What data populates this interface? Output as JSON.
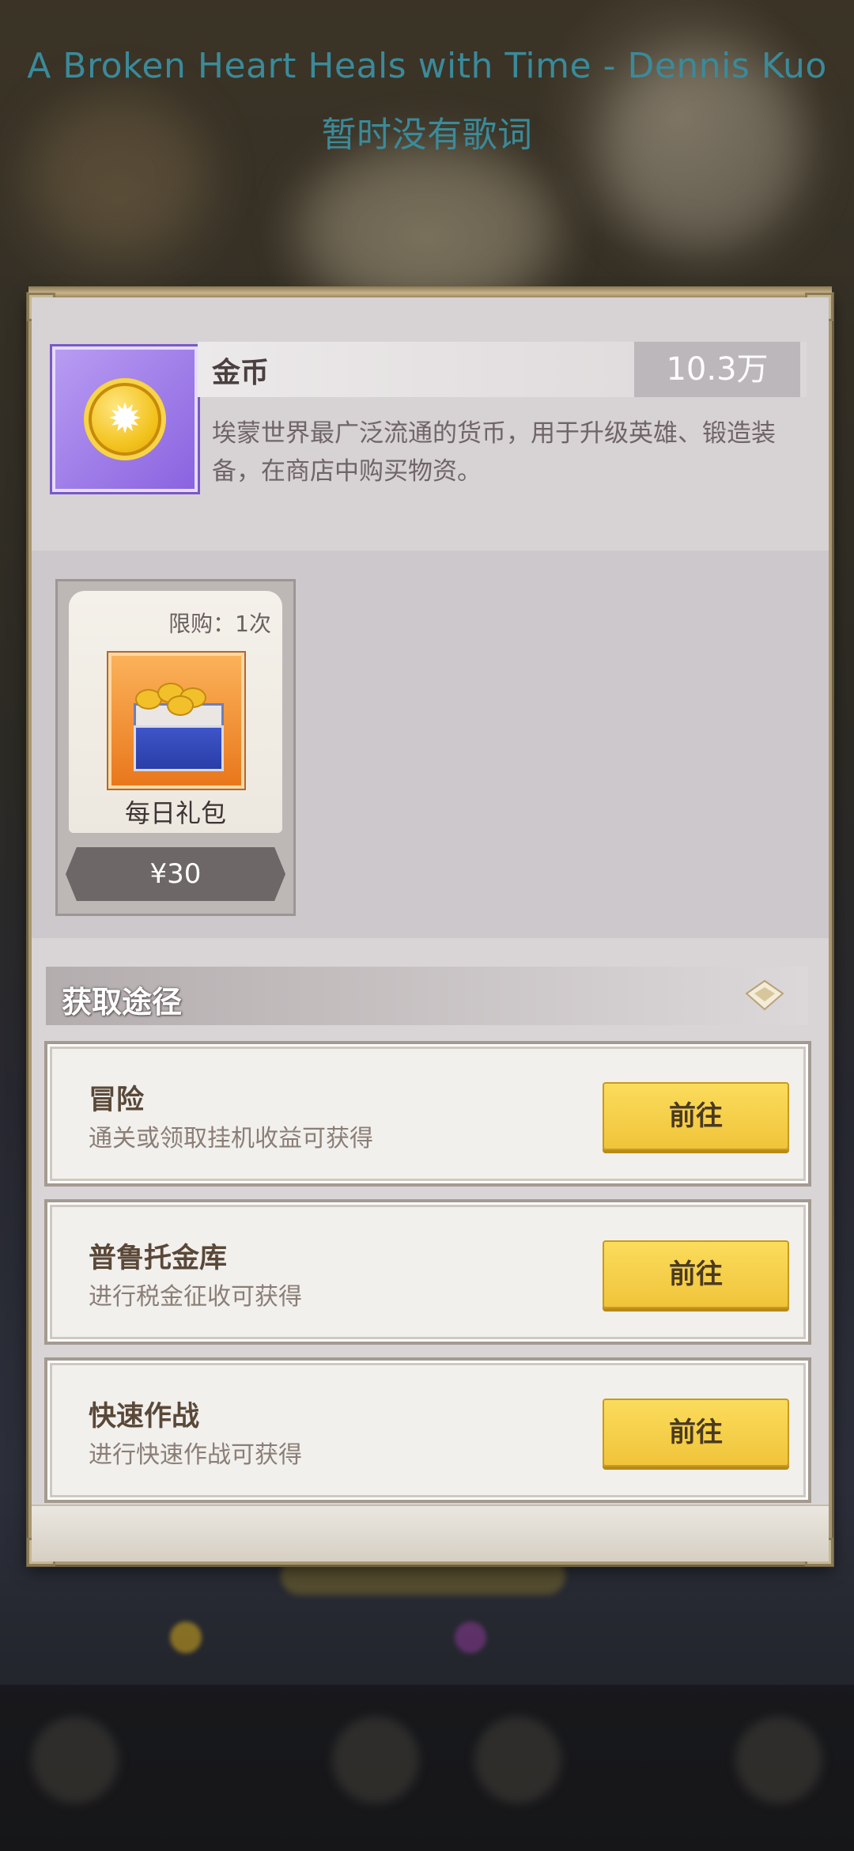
{
  "lyrics": {
    "line1": "A Broken Heart Heals with Time - Dennis Kuo",
    "line2": "暂时没有歌词"
  },
  "item": {
    "name": "金币",
    "quantity": "10.3万",
    "description": "埃蒙世界最广泛流通的货币，用于升级英雄、锻造装备，在商店中购买物资。",
    "icon": "gold-coin-icon"
  },
  "shop": {
    "pack_limit": "限购：1次",
    "pack_name": "每日礼包",
    "pack_price": "¥30"
  },
  "sources": {
    "header": "获取途径",
    "items": [
      {
        "title": "冒险",
        "desc": "通关或领取挂机收益可获得",
        "button": "前往"
      },
      {
        "title": "普鲁托金库",
        "desc": "进行税金征收可获得",
        "button": "前往"
      },
      {
        "title": "快速作战",
        "desc": "进行快速作战可获得",
        "button": "前往"
      }
    ]
  }
}
